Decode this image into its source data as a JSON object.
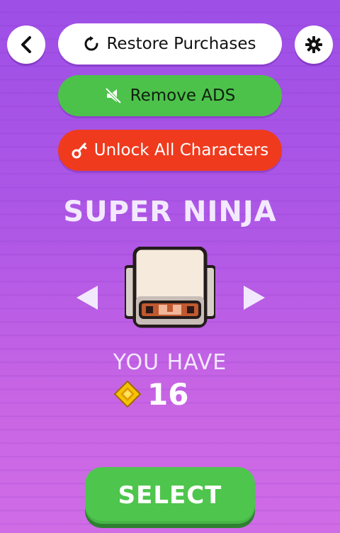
{
  "top_bar": {
    "back_icon": "chevron-left-icon",
    "restore_label": "Restore Purchases",
    "restore_icon": "refresh-icon",
    "settings_icon": "gear-icon"
  },
  "store": {
    "remove_ads_label": "Remove ADS",
    "remove_ads_icon": "muted-megaphone-icon",
    "unlock_label": "Unlock All Characters",
    "unlock_icon": "key-icon"
  },
  "character": {
    "name": "SUPER NINJA",
    "prev_icon": "triangle-left-icon",
    "next_icon": "triangle-right-icon"
  },
  "wallet": {
    "label": "YOU HAVE",
    "gem_icon": "diamond-gem-icon",
    "count": "16"
  },
  "actions": {
    "select_label": "SELECT"
  },
  "colors": {
    "green": "#4cc24a",
    "red": "#ef3a1e",
    "gem_yellow": "#f5c400"
  }
}
